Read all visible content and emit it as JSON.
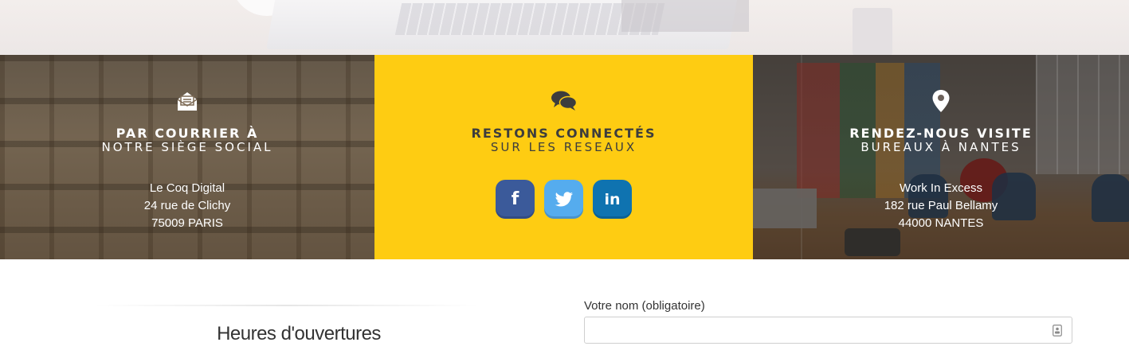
{
  "panels": {
    "courrier": {
      "icon": "envelope-open-icon",
      "title": "PAR COURRIER À",
      "subtitle": "NOTRE SIÈGE SOCIAL",
      "address": [
        "Le Coq Digital",
        "24 rue de Clichy",
        "75009 PARIS"
      ]
    },
    "reseaux": {
      "icon": "chat-bubbles-icon",
      "title": "RESTONS CONNECTÉS",
      "subtitle": "SUR LES RESEAUX",
      "social": [
        {
          "name": "facebook",
          "glyph": "f",
          "color": "#3b5a9a"
        },
        {
          "name": "twitter",
          "glyph": "twitter-bird-icon",
          "color": "#55acee"
        },
        {
          "name": "linkedin",
          "glyph": "in",
          "color": "#0f73b0"
        }
      ],
      "background": "#fecc12"
    },
    "visite": {
      "icon": "map-marker-icon",
      "title": "RENDEZ-NOUS VISITE",
      "subtitle": "BUREAUX À NANTES",
      "address": [
        "Work In Excess",
        "182 rue Paul Bellamy",
        "44000 NANTES"
      ]
    }
  },
  "hours": {
    "title": "Heures d'ouvertures"
  },
  "form": {
    "name_label": "Votre nom (obligatoire)",
    "name_value": "",
    "name_icon": "contact-card-icon"
  }
}
